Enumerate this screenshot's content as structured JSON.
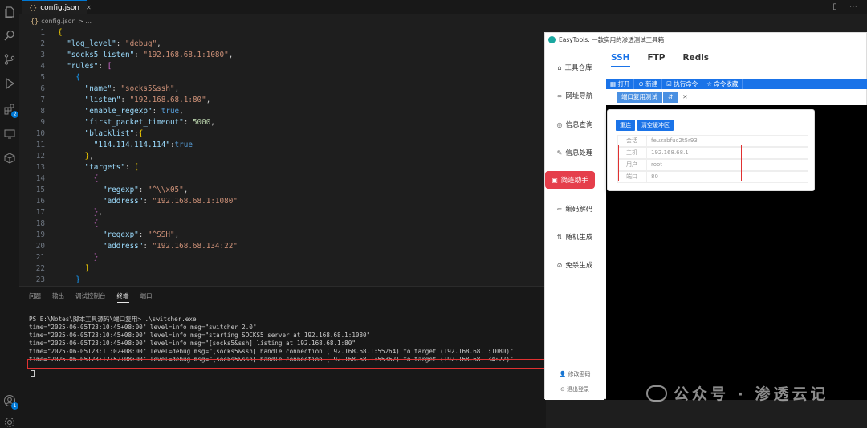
{
  "editor": {
    "tab": {
      "label": "config.json",
      "icon": "json-braces-icon"
    },
    "breadcrumb": "config.json > ...",
    "lines": [
      {
        "n": "1",
        "code": "{"
      },
      {
        "n": "2",
        "code": "  \"log_level\": \"debug\","
      },
      {
        "n": "3",
        "code": "  \"socks5_listen\": \"192.168.68.1:1080\","
      },
      {
        "n": "4",
        "code": "  \"rules\": ["
      },
      {
        "n": "5",
        "code": "    {"
      },
      {
        "n": "6",
        "code": "      \"name\": \"socks5&ssh\","
      },
      {
        "n": "7",
        "code": "      \"listen\": \"192.168.68.1:80\","
      },
      {
        "n": "8",
        "code": "      \"enable_regexp\": true,"
      },
      {
        "n": "9",
        "code": "      \"first_packet_timeout\": 5000,"
      },
      {
        "n": "10",
        "code": "      \"blacklist\":{"
      },
      {
        "n": "11",
        "code": "        \"114.114.114.114\":true"
      },
      {
        "n": "12",
        "code": "      },"
      },
      {
        "n": "13",
        "code": "      \"targets\": ["
      },
      {
        "n": "14",
        "code": "        {"
      },
      {
        "n": "15",
        "code": "          \"regexp\": \"^\\\\x05\","
      },
      {
        "n": "16",
        "code": "          \"address\": \"192.168.68.1:1080\""
      },
      {
        "n": "17",
        "code": "        },"
      },
      {
        "n": "18",
        "code": "        {"
      },
      {
        "n": "19",
        "code": "          \"regexp\": \"^SSH\","
      },
      {
        "n": "20",
        "code": "          \"address\": \"192.168.68.134:22\""
      },
      {
        "n": "21",
        "code": "        }"
      },
      {
        "n": "22",
        "code": "      ]"
      },
      {
        "n": "23",
        "code": "    }"
      }
    ]
  },
  "panel": {
    "tabs": [
      "问题",
      "输出",
      "调试控制台",
      "终端",
      "端口"
    ],
    "active_tab": "终端",
    "terminal": [
      "PS E:\\Notes\\脚本工具源码\\端口复用> .\\switcher.exe",
      "time=\"2025-06-05T23:10:45+08:00\" level=info msg=\"switcher 2.0\"",
      "time=\"2025-06-05T23:10:45+08:00\" level=info msg=\"starting SOCKS5 server at 192.168.68.1:1080\"",
      "time=\"2025-06-05T23:10:45+08:00\" level=info msg=\"[socks5&ssh] listing at 192.168.68.1:80\"",
      "time=\"2025-06-05T23:11:02+08:00\" level=debug msg=\"[socks5&ssh] handle connection (192.168.68.1:55264) to target (192.168.68.1:1080)\"",
      "time=\"2025-06-05T23:12:52+08:00\" level=debug msg=\"[socks5&ssh] handle connection (192.168.68.1:55362) to target (192.168.68.134:22)\""
    ]
  },
  "easytools": {
    "title": "EasyTools: 一款实用的渗透测试工具箱",
    "sidebar": [
      {
        "label": "工具仓库",
        "icon": "toolbox-icon"
      },
      {
        "label": "网址导航",
        "icon": "link-icon"
      },
      {
        "label": "信息查询",
        "icon": "chat-icon"
      },
      {
        "label": "信息处理",
        "icon": "edit-icon"
      },
      {
        "label": "简连助手",
        "icon": "connect-icon"
      },
      {
        "label": "编码解码",
        "icon": "code-icon"
      },
      {
        "label": "随机生成",
        "icon": "random-icon"
      },
      {
        "label": "免杀生成",
        "icon": "shield-icon"
      }
    ],
    "active_sidebar": "简连助手",
    "footer": {
      "change_password": "修改密码",
      "logout": "退出登录"
    },
    "tabs": [
      "SSH",
      "FTP",
      "Redis"
    ],
    "active_tab": "SSH",
    "toolbar": [
      "打开",
      "新建",
      "执行命令",
      "命令收藏"
    ],
    "subtab": "端口复用测试",
    "popup": {
      "buttons": [
        "重连",
        "清空缓冲区"
      ],
      "fields": [
        {
          "key": "会话",
          "value": "feuzabfuc2t5r93"
        },
        {
          "key": "主机",
          "value": "192.168.68.1"
        },
        {
          "key": "用户",
          "value": "root"
        },
        {
          "key": "端口",
          "value": "80"
        }
      ]
    }
  },
  "watermark": "公众号 · 渗透云记",
  "colors": {
    "accent": "#1a73e8",
    "active_sidebar": "#e53e4b",
    "highlight": "#e03131"
  }
}
